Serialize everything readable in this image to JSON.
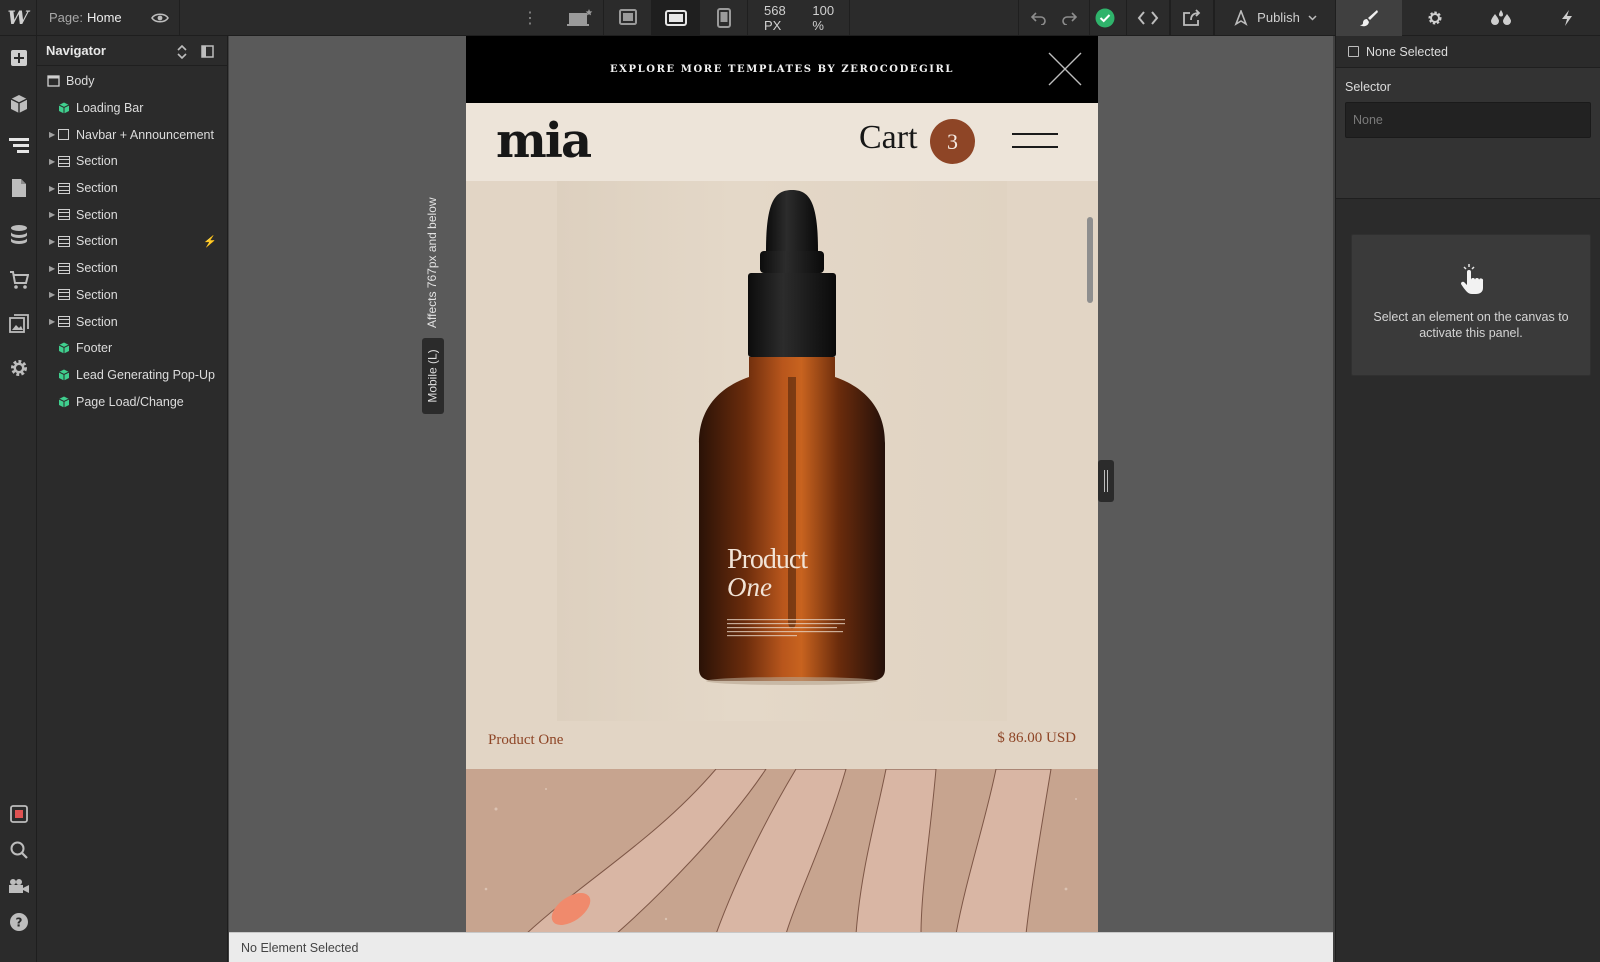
{
  "topbar": {
    "page_label": "Page:",
    "page_name": "Home",
    "width_value": "568 PX",
    "zoom_value": "100 %",
    "publish_label": "Publish"
  },
  "navigator": {
    "title": "Navigator",
    "items": [
      {
        "label": "Body",
        "type": "body",
        "caret": false
      },
      {
        "label": "Loading Bar",
        "type": "symbol",
        "caret": false
      },
      {
        "label": "Navbar + Announcement",
        "type": "box",
        "caret": true
      },
      {
        "label": "Section",
        "type": "section",
        "caret": true
      },
      {
        "label": "Section",
        "type": "section",
        "caret": true
      },
      {
        "label": "Section",
        "type": "section",
        "caret": true
      },
      {
        "label": "Section",
        "type": "section",
        "caret": true,
        "interaction": true
      },
      {
        "label": "Section",
        "type": "section",
        "caret": true
      },
      {
        "label": "Section",
        "type": "section",
        "caret": true
      },
      {
        "label": "Section",
        "type": "section",
        "caret": true
      },
      {
        "label": "Footer",
        "type": "symbol",
        "caret": false
      },
      {
        "label": "Lead Generating Pop-Up",
        "type": "symbol",
        "caret": false
      },
      {
        "label": "Page Load/Change",
        "type": "symbol",
        "caret": false
      }
    ]
  },
  "canvas": {
    "breakpoint_tab": "Mobile (L)",
    "breakpoint_hint": "Affects 767px and below",
    "site": {
      "announcement": "EXPLORE MORE TEMPLATES BY ZEROCODEGIRL",
      "logo": "mia",
      "cart_label": "Cart",
      "cart_count": "3",
      "product_label_line1": "Product",
      "product_label_line2": "One",
      "product_name": "Product One",
      "product_price": "$ 86.00 USD"
    }
  },
  "statusbar": {
    "text": "No Element Selected"
  },
  "right_panel": {
    "none_selected": "None Selected",
    "selector_label": "Selector",
    "selector_placeholder": "None",
    "hint_message": "Select an element on the canvas to activate this panel."
  },
  "colors": {
    "accent_brand": "#8e4526",
    "status_ok": "#2fb36b",
    "symbol_green": "#3fcf8e"
  }
}
